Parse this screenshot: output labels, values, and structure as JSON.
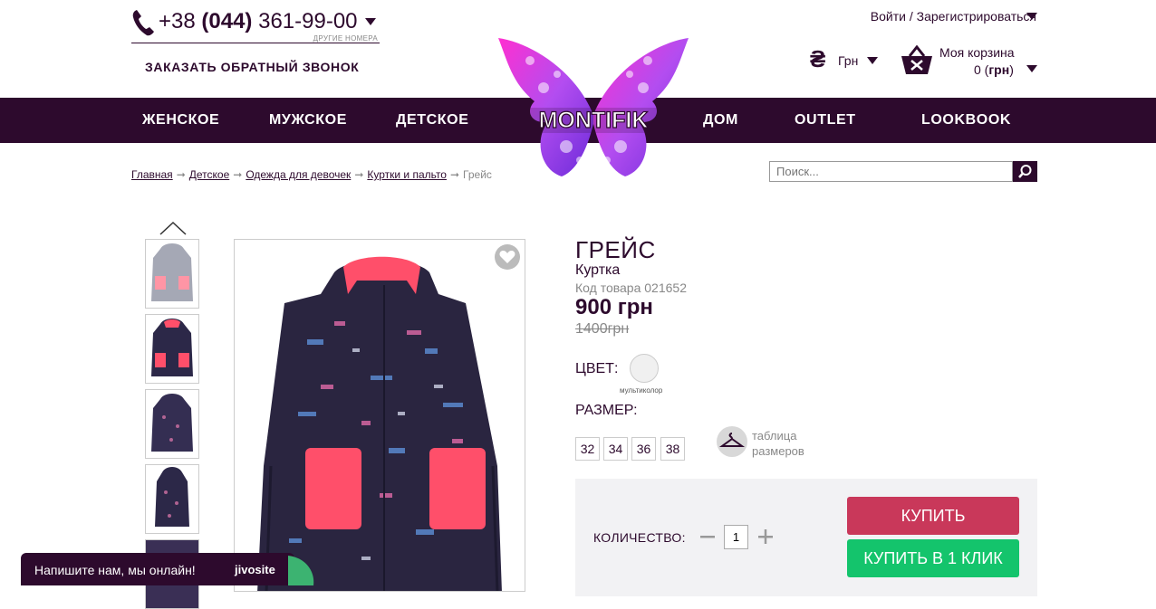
{
  "header": {
    "phone_prefix": "+38 ",
    "phone_code": "(044)",
    "phone_number": " 361-99-00",
    "other_numbers": "ДРУГИЕ НОМЕРА",
    "callback": "ЗАКАЗАТЬ ОБРАТНЫЙ ЗВОНОК",
    "login": "Войти / Зарегистрироваться",
    "currency_symbol": "₴",
    "currency": "Грн",
    "cart_title": "Моя корзина",
    "cart_count": "0 (",
    "cart_unit": "грн",
    "cart_close": ")"
  },
  "logo_text": "MONTIFIK",
  "nav": {
    "items": [
      "ЖЕНСКОЕ",
      "МУЖСКОЕ",
      "ДЕТСКОЕ",
      "ДОМ",
      "OUTLET",
      "LOOKBOOK"
    ]
  },
  "breadcrumb": {
    "items": [
      "Главная",
      "Детское",
      "Одежда для девочек",
      "Куртки и пальто"
    ],
    "current": "Грейс",
    "separator": "➞"
  },
  "search": {
    "placeholder": "Поиск..."
  },
  "product": {
    "title": "ГРЕЙС",
    "subtitle": "Куртка",
    "code": "Код товара 021652",
    "price": "900 грн",
    "old_price": "1400грн",
    "color_label": "ЦВЕТ:",
    "color_name": "мультиколор",
    "size_label": "РАЗМЕР:",
    "sizes": [
      "32",
      "34",
      "36",
      "38"
    ],
    "size_table_line1": "таблица",
    "size_table_line2": "размеров",
    "quantity_label": "КОЛИЧЕСТВО:",
    "quantity": "1",
    "buy_label": "КУПИТЬ",
    "one_click_label": "КУПИТЬ В 1 КЛИК"
  },
  "chat": {
    "text": "Напишите нам, мы онлайн!",
    "brand": "jivosite"
  },
  "icons": {
    "phone": "phone-icon",
    "basket": "basket-icon",
    "search": "search-icon",
    "heart": "heart-icon",
    "hanger": "hanger-icon",
    "up": "chevron-up-icon"
  },
  "colors": {
    "brand": "#2d0a2d",
    "buy": "#c9385a",
    "one_click": "#14c46c",
    "jacket_accent": "#ff4f6a"
  }
}
